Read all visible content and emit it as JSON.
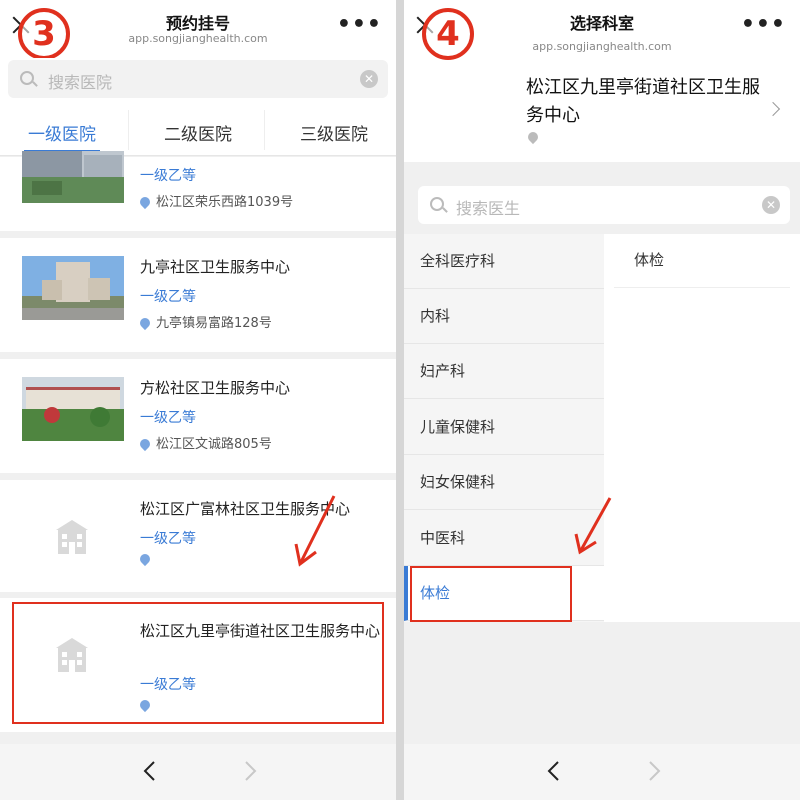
{
  "left": {
    "step": "3",
    "title": "预约挂号",
    "url": "app.songjianghealth.com",
    "more": "•••",
    "search_placeholder": "搜索医院",
    "tabs": [
      "一级医院",
      "二级医院",
      "三级医院"
    ],
    "hospitals": [
      {
        "name": "",
        "level": "一级乙等",
        "address": "松江区荣乐西路1039号"
      },
      {
        "name": "九亭社区卫生服务中心",
        "level": "一级乙等",
        "address": "九亭镇易富路128号"
      },
      {
        "name": "方松社区卫生服务中心",
        "level": "一级乙等",
        "address": "松江区文诚路805号"
      },
      {
        "name": "松江区广富林社区卫生服务中心",
        "level": "一级乙等",
        "address": ""
      },
      {
        "name": "松江区九里亭街道社区卫生服务中心",
        "level": "一级乙等",
        "address": ""
      }
    ]
  },
  "right": {
    "step": "4",
    "title": "选择科室",
    "url": "app.songjianghealth.com",
    "more": "•••",
    "hospital_name": "松江区九里亭街道社区卫生服务中心",
    "search_placeholder": "搜索医生",
    "departments": [
      "全科医疗科",
      "内科",
      "妇产科",
      "儿童保健科",
      "妇女保健科",
      "中医科",
      "体检"
    ],
    "active_department": "体检",
    "sub_departments": [
      "体检"
    ]
  },
  "colors": {
    "accent": "#3a7bd5",
    "highlight": "#e0301e"
  }
}
